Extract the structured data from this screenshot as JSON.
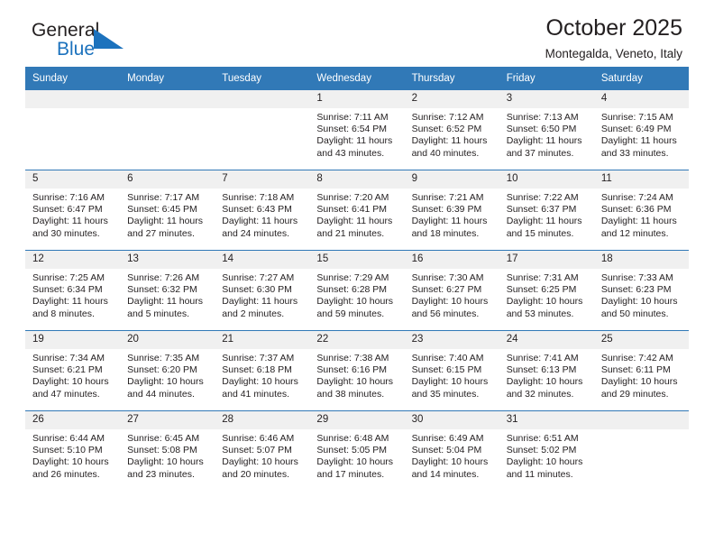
{
  "brand": {
    "name_top": "General",
    "name_bottom": "Blue",
    "triangle_color": "#1c72bd"
  },
  "header": {
    "title": "October 2025",
    "subtitle": "Montegalda, Veneto, Italy"
  },
  "theme": {
    "header_bar": "#3179b7",
    "daynum_band": "#f0f0f0",
    "text": "#231f20"
  },
  "weekdays": [
    "Sunday",
    "Monday",
    "Tuesday",
    "Wednesday",
    "Thursday",
    "Friday",
    "Saturday"
  ],
  "labels": {
    "sunrise_prefix": "Sunrise: ",
    "sunset_prefix": "Sunset: ",
    "daylight_prefix": "Daylight: "
  },
  "weeks": [
    [
      {
        "day": "",
        "blank": true
      },
      {
        "day": "",
        "blank": true
      },
      {
        "day": "",
        "blank": true
      },
      {
        "day": "1",
        "sunrise": "Sunrise: 7:11 AM",
        "sunset": "Sunset: 6:54 PM",
        "daylight": "Daylight: 11 hours and 43 minutes."
      },
      {
        "day": "2",
        "sunrise": "Sunrise: 7:12 AM",
        "sunset": "Sunset: 6:52 PM",
        "daylight": "Daylight: 11 hours and 40 minutes."
      },
      {
        "day": "3",
        "sunrise": "Sunrise: 7:13 AM",
        "sunset": "Sunset: 6:50 PM",
        "daylight": "Daylight: 11 hours and 37 minutes."
      },
      {
        "day": "4",
        "sunrise": "Sunrise: 7:15 AM",
        "sunset": "Sunset: 6:49 PM",
        "daylight": "Daylight: 11 hours and 33 minutes."
      }
    ],
    [
      {
        "day": "5",
        "sunrise": "Sunrise: 7:16 AM",
        "sunset": "Sunset: 6:47 PM",
        "daylight": "Daylight: 11 hours and 30 minutes."
      },
      {
        "day": "6",
        "sunrise": "Sunrise: 7:17 AM",
        "sunset": "Sunset: 6:45 PM",
        "daylight": "Daylight: 11 hours and 27 minutes."
      },
      {
        "day": "7",
        "sunrise": "Sunrise: 7:18 AM",
        "sunset": "Sunset: 6:43 PM",
        "daylight": "Daylight: 11 hours and 24 minutes."
      },
      {
        "day": "8",
        "sunrise": "Sunrise: 7:20 AM",
        "sunset": "Sunset: 6:41 PM",
        "daylight": "Daylight: 11 hours and 21 minutes."
      },
      {
        "day": "9",
        "sunrise": "Sunrise: 7:21 AM",
        "sunset": "Sunset: 6:39 PM",
        "daylight": "Daylight: 11 hours and 18 minutes."
      },
      {
        "day": "10",
        "sunrise": "Sunrise: 7:22 AM",
        "sunset": "Sunset: 6:37 PM",
        "daylight": "Daylight: 11 hours and 15 minutes."
      },
      {
        "day": "11",
        "sunrise": "Sunrise: 7:24 AM",
        "sunset": "Sunset: 6:36 PM",
        "daylight": "Daylight: 11 hours and 12 minutes."
      }
    ],
    [
      {
        "day": "12",
        "sunrise": "Sunrise: 7:25 AM",
        "sunset": "Sunset: 6:34 PM",
        "daylight": "Daylight: 11 hours and 8 minutes."
      },
      {
        "day": "13",
        "sunrise": "Sunrise: 7:26 AM",
        "sunset": "Sunset: 6:32 PM",
        "daylight": "Daylight: 11 hours and 5 minutes."
      },
      {
        "day": "14",
        "sunrise": "Sunrise: 7:27 AM",
        "sunset": "Sunset: 6:30 PM",
        "daylight": "Daylight: 11 hours and 2 minutes."
      },
      {
        "day": "15",
        "sunrise": "Sunrise: 7:29 AM",
        "sunset": "Sunset: 6:28 PM",
        "daylight": "Daylight: 10 hours and 59 minutes."
      },
      {
        "day": "16",
        "sunrise": "Sunrise: 7:30 AM",
        "sunset": "Sunset: 6:27 PM",
        "daylight": "Daylight: 10 hours and 56 minutes."
      },
      {
        "day": "17",
        "sunrise": "Sunrise: 7:31 AM",
        "sunset": "Sunset: 6:25 PM",
        "daylight": "Daylight: 10 hours and 53 minutes."
      },
      {
        "day": "18",
        "sunrise": "Sunrise: 7:33 AM",
        "sunset": "Sunset: 6:23 PM",
        "daylight": "Daylight: 10 hours and 50 minutes."
      }
    ],
    [
      {
        "day": "19",
        "sunrise": "Sunrise: 7:34 AM",
        "sunset": "Sunset: 6:21 PM",
        "daylight": "Daylight: 10 hours and 47 minutes."
      },
      {
        "day": "20",
        "sunrise": "Sunrise: 7:35 AM",
        "sunset": "Sunset: 6:20 PM",
        "daylight": "Daylight: 10 hours and 44 minutes."
      },
      {
        "day": "21",
        "sunrise": "Sunrise: 7:37 AM",
        "sunset": "Sunset: 6:18 PM",
        "daylight": "Daylight: 10 hours and 41 minutes."
      },
      {
        "day": "22",
        "sunrise": "Sunrise: 7:38 AM",
        "sunset": "Sunset: 6:16 PM",
        "daylight": "Daylight: 10 hours and 38 minutes."
      },
      {
        "day": "23",
        "sunrise": "Sunrise: 7:40 AM",
        "sunset": "Sunset: 6:15 PM",
        "daylight": "Daylight: 10 hours and 35 minutes."
      },
      {
        "day": "24",
        "sunrise": "Sunrise: 7:41 AM",
        "sunset": "Sunset: 6:13 PM",
        "daylight": "Daylight: 10 hours and 32 minutes."
      },
      {
        "day": "25",
        "sunrise": "Sunrise: 7:42 AM",
        "sunset": "Sunset: 6:11 PM",
        "daylight": "Daylight: 10 hours and 29 minutes."
      }
    ],
    [
      {
        "day": "26",
        "sunrise": "Sunrise: 6:44 AM",
        "sunset": "Sunset: 5:10 PM",
        "daylight": "Daylight: 10 hours and 26 minutes."
      },
      {
        "day": "27",
        "sunrise": "Sunrise: 6:45 AM",
        "sunset": "Sunset: 5:08 PM",
        "daylight": "Daylight: 10 hours and 23 minutes."
      },
      {
        "day": "28",
        "sunrise": "Sunrise: 6:46 AM",
        "sunset": "Sunset: 5:07 PM",
        "daylight": "Daylight: 10 hours and 20 minutes."
      },
      {
        "day": "29",
        "sunrise": "Sunrise: 6:48 AM",
        "sunset": "Sunset: 5:05 PM",
        "daylight": "Daylight: 10 hours and 17 minutes."
      },
      {
        "day": "30",
        "sunrise": "Sunrise: 6:49 AM",
        "sunset": "Sunset: 5:04 PM",
        "daylight": "Daylight: 10 hours and 14 minutes."
      },
      {
        "day": "31",
        "sunrise": "Sunrise: 6:51 AM",
        "sunset": "Sunset: 5:02 PM",
        "daylight": "Daylight: 10 hours and 11 minutes."
      },
      {
        "day": "",
        "blank": true
      }
    ]
  ]
}
